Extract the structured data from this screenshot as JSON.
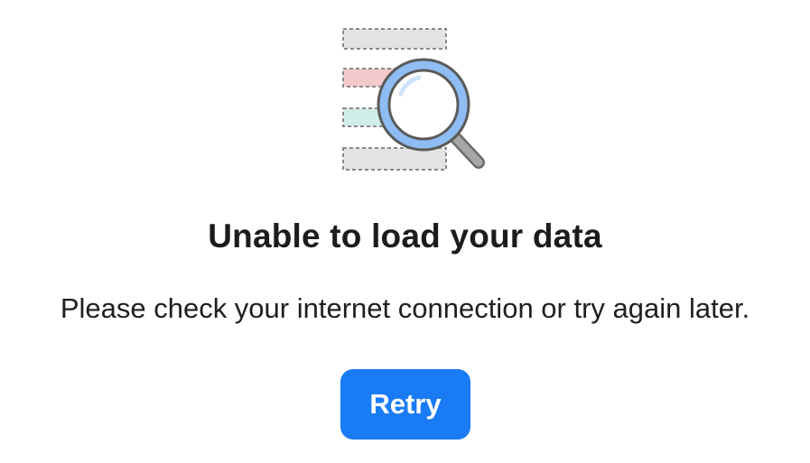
{
  "empty_state": {
    "illustration_icon": "document-search-icon",
    "title": "Unable to load your data",
    "message": "Please check your internet connection or try again later.",
    "retry_label": "Retry"
  },
  "colors": {
    "accent": "#1a7cf5",
    "placeholder_gray": "#e3e3e3",
    "placeholder_pink": "#f4c9cc",
    "placeholder_teal": "#cfeeea",
    "lens_blue": "#8fbdf3",
    "handle_gray": "#9a9a9a"
  }
}
